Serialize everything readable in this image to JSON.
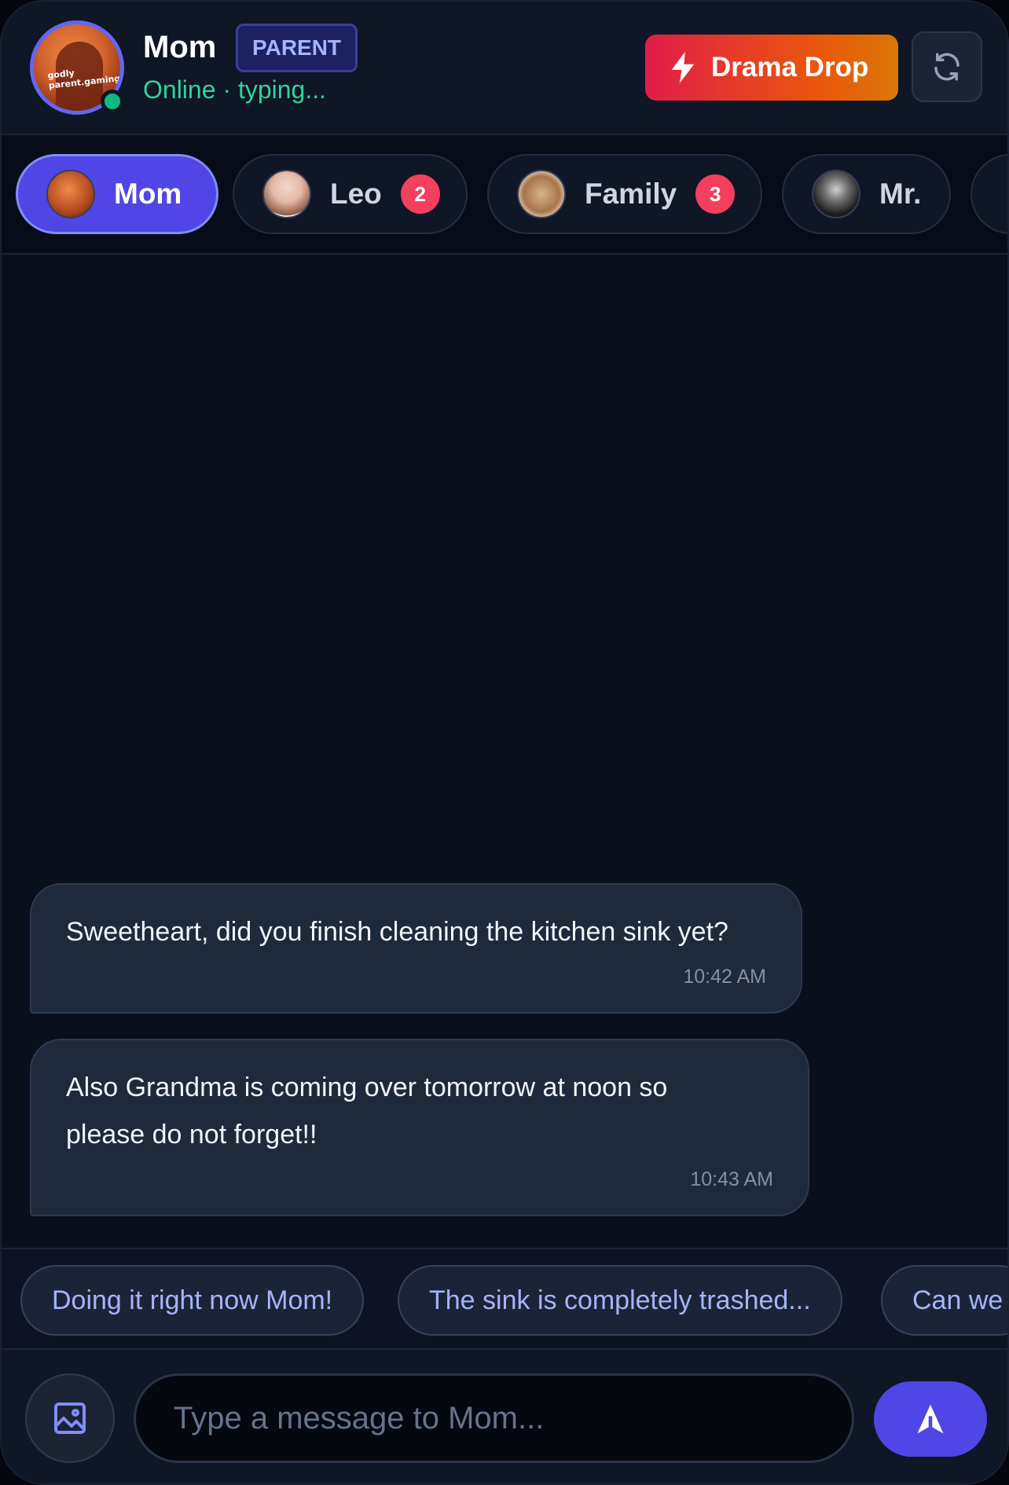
{
  "header": {
    "contact_name": "Mom",
    "role_badge": "PARENT",
    "status": "Online · typing...",
    "avatar_caption": "godly parent.gaming",
    "drama_button": "Drama Drop"
  },
  "tabs": [
    {
      "label": "Mom",
      "badge": null,
      "active": true
    },
    {
      "label": "Leo",
      "badge": "2",
      "active": false
    },
    {
      "label": "Family",
      "badge": "3",
      "active": false
    },
    {
      "label": "Mr.",
      "badge": null,
      "active": false
    }
  ],
  "messages": [
    {
      "text": "Sweetheart, did you finish cleaning the kitchen sink yet?",
      "time": "10:42 AM"
    },
    {
      "text": "Also Grandma is coming over tomorrow at noon so please do not forget!!",
      "time": "10:43 AM"
    }
  ],
  "quick_replies": [
    "Doing it right now Mom!",
    "The sink is completely trashed...",
    "Can we"
  ],
  "composer": {
    "placeholder": "Type a message to Mom..."
  },
  "colors": {
    "accent": "#4f46e5",
    "online": "#10b981",
    "badge": "#f43f5e",
    "drama_gradient_start": "#e11d48",
    "drama_gradient_end": "#d97706"
  }
}
